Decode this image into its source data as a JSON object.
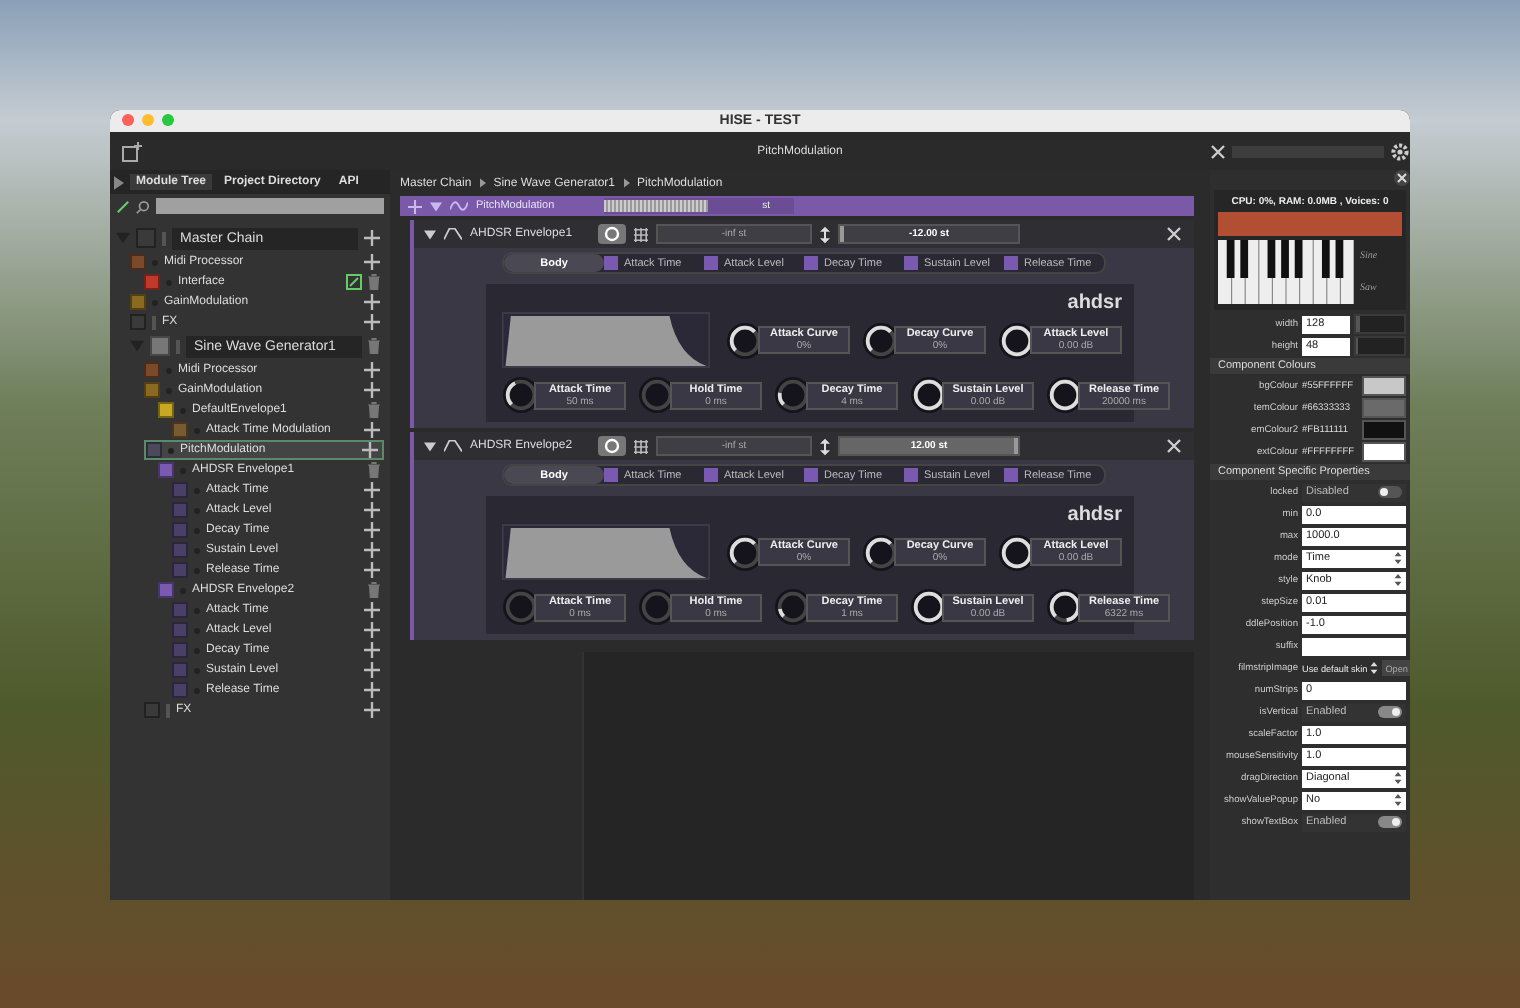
{
  "window": {
    "title": "HISE - TEST"
  },
  "toolbar": {
    "title": "PitchModulation"
  },
  "left_tabs": [
    {
      "label": "Module Tree",
      "selected": true
    },
    {
      "label": "Project Directory",
      "selected": false
    },
    {
      "label": "API",
      "selected": false
    }
  ],
  "module_tree": [
    {
      "label": "Master Chain",
      "kind": "chain",
      "color": "#3a3a3a",
      "selected": false,
      "removable": false,
      "children": [
        {
          "label": "Midi Processor",
          "kind": "module",
          "color": "#7a4a2a",
          "selected": false,
          "removable": false,
          "children": [
            {
              "label": "Interface",
              "kind": "module",
              "color": "#c0392b",
              "selected": false,
              "removable": true,
              "editable": true
            }
          ]
        },
        {
          "label": "GainModulation",
          "kind": "module",
          "color": "#8a6a20",
          "selected": false,
          "removable": false
        },
        {
          "label": "FX",
          "kind": "group",
          "color": "#3a3a3a",
          "selected": false,
          "removable": false
        },
        {
          "label": "Sine Wave Generator1",
          "kind": "chain",
          "color": "#777777",
          "selected": false,
          "removable": true,
          "children": [
            {
              "label": "Midi Processor",
              "kind": "module",
              "color": "#7a4a2a",
              "selected": false,
              "removable": false
            },
            {
              "label": "GainModulation",
              "kind": "module",
              "color": "#8a6a20",
              "selected": false,
              "removable": false,
              "children": [
                {
                  "label": "DefaultEnvelope1",
                  "kind": "module",
                  "color": "#c8a820",
                  "selected": false,
                  "removable": true,
                  "children": [
                    {
                      "label": "Attack Time Modulation",
                      "kind": "module",
                      "color": "#7a5a30",
                      "selected": false,
                      "removable": false
                    }
                  ]
                }
              ]
            },
            {
              "label": "PitchModulation",
              "kind": "module",
              "color": "#4a4a5a",
              "selected": true,
              "removable": false,
              "children": [
                {
                  "label": "AHDSR Envelope1",
                  "kind": "module",
                  "color": "#7a5ab0",
                  "selected": false,
                  "removable": true,
                  "children": [
                    {
                      "label": "Attack Time",
                      "kind": "module",
                      "color": "#4a3f66",
                      "selected": false,
                      "removable": false
                    },
                    {
                      "label": "Attack Level",
                      "kind": "module",
                      "color": "#4a3f66",
                      "selected": false,
                      "removable": false
                    },
                    {
                      "label": "Decay Time",
                      "kind": "module",
                      "color": "#4a3f66",
                      "selected": false,
                      "removable": false
                    },
                    {
                      "label": "Sustain Level",
                      "kind": "module",
                      "color": "#4a3f66",
                      "selected": false,
                      "removable": false
                    },
                    {
                      "label": "Release Time",
                      "kind": "module",
                      "color": "#4a3f66",
                      "selected": false,
                      "removable": false
                    }
                  ]
                },
                {
                  "label": "AHDSR Envelope2",
                  "kind": "module",
                  "color": "#7a5ab0",
                  "selected": false,
                  "removable": true,
                  "children": [
                    {
                      "label": "Attack Time",
                      "kind": "module",
                      "color": "#4a3f66",
                      "selected": false,
                      "removable": false
                    },
                    {
                      "label": "Attack Level",
                      "kind": "module",
                      "color": "#4a3f66",
                      "selected": false,
                      "removable": false
                    },
                    {
                      "label": "Decay Time",
                      "kind": "module",
                      "color": "#4a3f66",
                      "selected": false,
                      "removable": false
                    },
                    {
                      "label": "Sustain Level",
                      "kind": "module",
                      "color": "#4a3f66",
                      "selected": false,
                      "removable": false
                    },
                    {
                      "label": "Release Time",
                      "kind": "module",
                      "color": "#4a3f66",
                      "selected": false,
                      "removable": false
                    }
                  ]
                }
              ]
            },
            {
              "label": "FX",
              "kind": "group",
              "color": "#3a3a3a",
              "selected": false,
              "removable": false
            }
          ]
        }
      ]
    }
  ],
  "breadcrumb": [
    "Master Chain",
    "Sine Wave Generator1",
    "PitchModulation"
  ],
  "chain_header": {
    "title": "PitchModulation",
    "unit": "st",
    "level": 0.55
  },
  "envelopes": [
    {
      "name": "AHDSR Envelope1",
      "mod_range": "-inf st",
      "pitch": {
        "value": "-12.00 st",
        "level": 0.0
      },
      "brand": "ahdsr",
      "tabs": [
        {
          "label": "Body",
          "selected": true
        },
        {
          "label": "Attack Time",
          "selected": false
        },
        {
          "label": "Attack Level",
          "selected": false
        },
        {
          "label": "Decay Time",
          "selected": false
        },
        {
          "label": "Sustain Level",
          "selected": false
        },
        {
          "label": "Release Time",
          "selected": false
        }
      ],
      "knobs": [
        {
          "label": "Attack Curve",
          "value": "0%",
          "level": 0.5
        },
        {
          "label": "Decay Curve",
          "value": "0%",
          "level": 0.5
        },
        {
          "label": "Attack Level",
          "value": "0.00 dB",
          "level": 1.0
        },
        {
          "label": "Attack Time",
          "value": "50 ms",
          "level": 0.3
        },
        {
          "label": "Hold Time",
          "value": "0 ms",
          "level": 0.0
        },
        {
          "label": "Decay Time",
          "value": "4 ms",
          "level": 0.15
        },
        {
          "label": "Sustain Level",
          "value": "0.00 dB",
          "level": 1.0
        },
        {
          "label": "Release Time",
          "value": "20000 ms",
          "level": 1.0
        }
      ]
    },
    {
      "name": "AHDSR Envelope2",
      "mod_range": "-inf st",
      "pitch": {
        "value": "12.00 st",
        "level": 1.0
      },
      "brand": "ahdsr",
      "tabs": [
        {
          "label": "Body",
          "selected": true
        },
        {
          "label": "Attack Time",
          "selected": false
        },
        {
          "label": "Attack Level",
          "selected": false
        },
        {
          "label": "Decay Time",
          "selected": false
        },
        {
          "label": "Sustain Level",
          "selected": false
        },
        {
          "label": "Release Time",
          "selected": false
        }
      ],
      "knobs": [
        {
          "label": "Attack Curve",
          "value": "0%",
          "level": 0.5
        },
        {
          "label": "Decay Curve",
          "value": "0%",
          "level": 0.5
        },
        {
          "label": "Attack Level",
          "value": "0.00 dB",
          "level": 1.0
        },
        {
          "label": "Attack Time",
          "value": "0 ms",
          "level": 0.0
        },
        {
          "label": "Hold Time",
          "value": "0 ms",
          "level": 0.0
        },
        {
          "label": "Decay Time",
          "value": "1 ms",
          "level": 0.1
        },
        {
          "label": "Sustain Level",
          "value": "0.00 dB",
          "level": 1.0
        },
        {
          "label": "Release Time",
          "value": "6322 ms",
          "level": 0.85
        }
      ]
    }
  ],
  "preview": {
    "status": "CPU: 0%, RAM: 0.0MB , Voices: 0",
    "keyboard_labels": [
      "Sine",
      "Saw"
    ]
  },
  "size_props": [
    {
      "label": "width",
      "value": "128",
      "level": 0.1
    },
    {
      "label": "height",
      "value": "48",
      "level": 0.05
    }
  ],
  "colour_section": {
    "title": "Component Colours",
    "rows": [
      {
        "label": "bgColour",
        "value": "#55FFFFFF",
        "color": "#c8c8c8"
      },
      {
        "label": "temColour",
        "value": "#66333333",
        "color": "#6a6a6a"
      },
      {
        "label": "emColour2",
        "value": "#FB111111",
        "color": "#111111"
      },
      {
        "label": "extColour",
        "value": "#FFFFFFFF",
        "color": "#ffffff"
      }
    ]
  },
  "specific_section": {
    "title": "Component Specific Properties",
    "rows": [
      {
        "label": "locked",
        "kind": "toggle",
        "value": "Disabled",
        "on": false
      },
      {
        "label": "min",
        "kind": "text",
        "value": "0.0"
      },
      {
        "label": "max",
        "kind": "text",
        "value": "1000.0"
      },
      {
        "label": "mode",
        "kind": "select",
        "value": "Time"
      },
      {
        "label": "style",
        "kind": "select",
        "value": "Knob"
      },
      {
        "label": "stepSize",
        "kind": "text",
        "value": "0.01"
      },
      {
        "label": "ddlePosition",
        "kind": "text",
        "value": "-1.0"
      },
      {
        "label": "suffix",
        "kind": "text"
      },
      {
        "label": "filmstripImage",
        "kind": "file",
        "value": "Use default skin",
        "button": "Open"
      },
      {
        "label": "numStrips",
        "kind": "text",
        "value": "0"
      },
      {
        "label": "isVertical",
        "kind": "toggle",
        "value": "Enabled",
        "on": true
      },
      {
        "label": "scaleFactor",
        "kind": "text",
        "value": "1.0"
      },
      {
        "label": "mouseSensitivity",
        "kind": "text",
        "value": "1.0"
      },
      {
        "label": "dragDirection",
        "kind": "select",
        "value": "Diagonal"
      },
      {
        "label": "showValuePopup",
        "kind": "select",
        "value": "No"
      },
      {
        "label": "showTextBox",
        "kind": "toggle",
        "value": "Enabled",
        "on": true
      }
    ]
  }
}
